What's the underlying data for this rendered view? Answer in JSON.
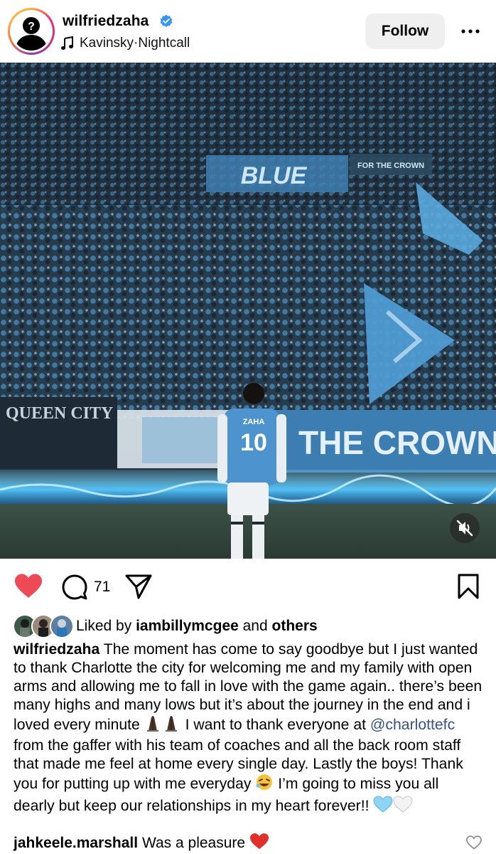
{
  "header": {
    "username": "wilfriedzaha",
    "verified": true,
    "music_artist": "Kavinsky",
    "music_sep": " · ",
    "music_track": "Nightcall",
    "follow_label": "Follow"
  },
  "media": {
    "jersey_name": "ZAHA",
    "jersey_number": "10",
    "banner_left": "QUEEN CITY",
    "banner_right": "THE CROWN",
    "banner_top": "BLUE",
    "banner_top_right": "FOR THE CROWN"
  },
  "actions": {
    "liked": true,
    "comment_count": "71"
  },
  "likes": {
    "prefix": "Liked by ",
    "user": "iambillymcgee",
    "middle": " and ",
    "others": "others"
  },
  "caption": {
    "author": "wilfriedzaha",
    "part1": " The moment has come to say goodbye but I just wanted to thank Charlotte the city for welcoming me and my family with open arms and allowing me to fall in love with the game again.. there’s been many highs and many lows but it’s about the journey in the end and i loved every minute ",
    "part2": " I want to thank everyone at ",
    "mention": "@charlottefc",
    "part3": " from the gaffer with his team of coaches and all the back room staff that made me feel at home every single day. Lastly the boys! Thank you for putting up with me everyday ",
    "part4": " I’m going to miss you all dearly but keep our relationships in my heart forever!! "
  },
  "comment": {
    "author": "jahkeele.marshall",
    "text": " Was a pleasure "
  },
  "colors": {
    "like_red": "#ed4956",
    "mention_blue": "#385185",
    "verified_blue": "#3797f0"
  },
  "icons": [
    "music-note-icon",
    "verified-badge-icon",
    "more-icon",
    "heart-icon",
    "comment-icon",
    "share-icon",
    "bookmark-icon",
    "mute-icon"
  ]
}
